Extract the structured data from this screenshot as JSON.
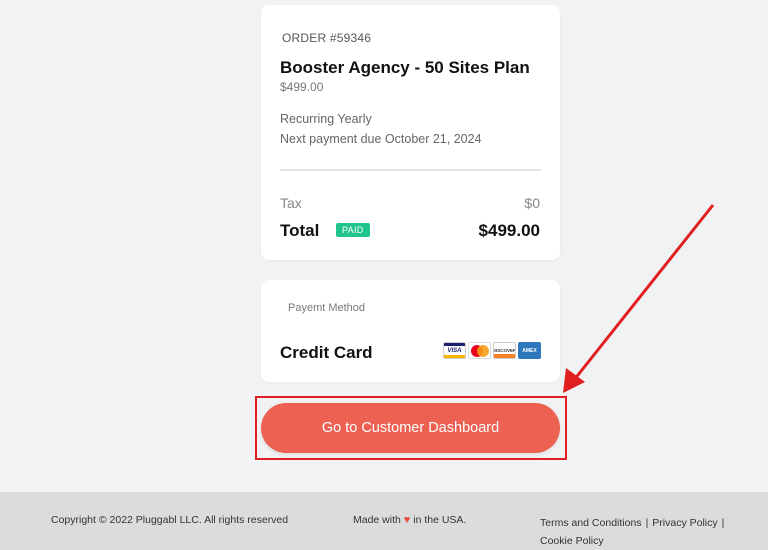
{
  "order": {
    "number": "ORDER #59346",
    "plan_name": "Booster Agency - 50 Sites Plan",
    "plan_price": "$499.00",
    "recurring": "Recurring Yearly",
    "next_payment": "Next payment due October 21, 2024",
    "tax_label": "Tax",
    "tax_value": "$0",
    "total_label": "Total",
    "paid_badge": "PAID",
    "total_value": "$499.00"
  },
  "payment": {
    "label": "Payemt Method",
    "type": "Credit Card",
    "logos": {
      "visa": "VISA",
      "discover": "DISCOVER",
      "amex": "AMEX"
    }
  },
  "cta": {
    "label": "Go to Customer Dashboard"
  },
  "footer": {
    "copyright": "Copyright © 2022 Pluggabl LLC. All rights reserved",
    "made_with_prefix": "Made with",
    "made_with_suffix": "in the USA.",
    "heart": "♥",
    "links": {
      "terms": "Terms and Conditions",
      "privacy": "Privacy Policy",
      "cookie": "Cookie Policy",
      "separator": "|"
    }
  },
  "colors": {
    "accent_button": "#ed6153",
    "paid_badge": "#21c38f",
    "annotation_red": "#e02020",
    "page_bg": "#f1f2f4",
    "footer_bg": "#dcdcdc"
  }
}
